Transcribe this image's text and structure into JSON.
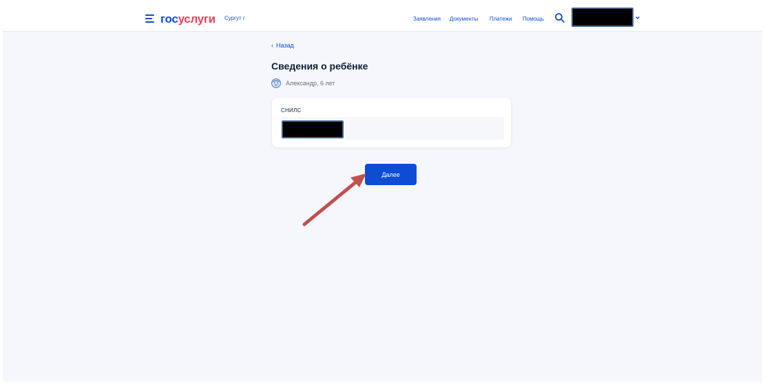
{
  "header": {
    "logo_part1": "гос",
    "logo_part2": "услуги",
    "region": "Сургут г",
    "nav": [
      "Заявления",
      "Документы",
      "Платежи",
      "Помощь"
    ]
  },
  "page": {
    "back_label": "Назад",
    "title": "Сведения о ребёнке",
    "child_name": "Александр, 6 лет"
  },
  "form": {
    "snils_label": "СНИЛС"
  },
  "actions": {
    "next_label": "Далее"
  },
  "colors": {
    "brand_blue": "#0d4cd3",
    "brand_red": "#ee3f58",
    "annotation_arrow": "#c0504d",
    "background": "#f5f7fc"
  },
  "icons": {
    "menu": "menu-icon",
    "search": "search-icon",
    "account_dropdown": "chevron-down-icon",
    "back": "chevron-left-icon",
    "child": "child-avatar-icon"
  }
}
